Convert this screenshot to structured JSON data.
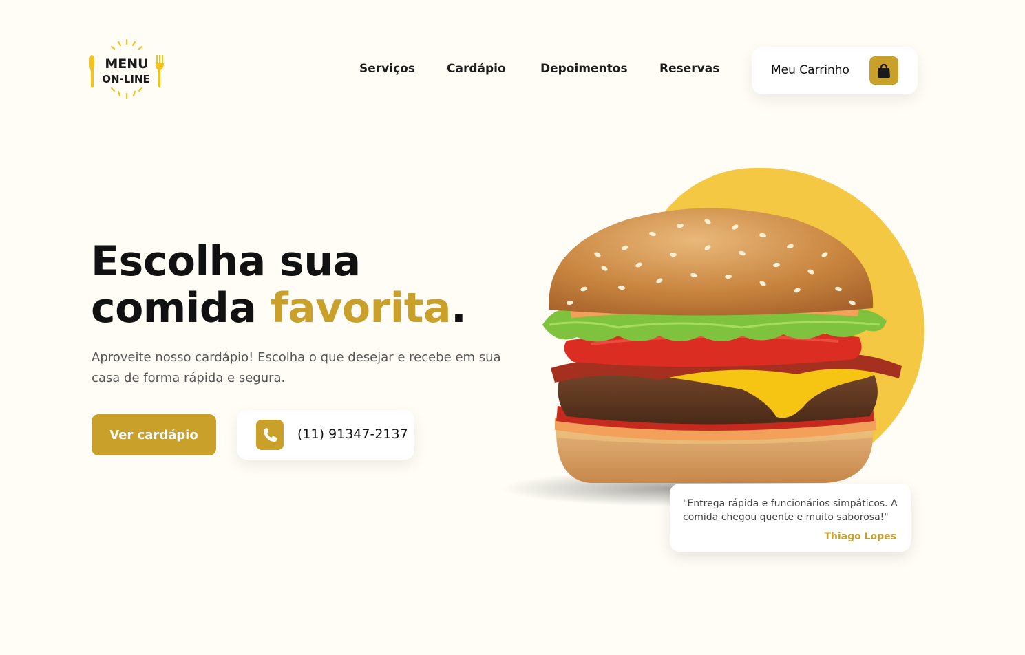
{
  "brand": {
    "logo_line1": "MENU",
    "logo_line2": "ON-LINE",
    "logo_color": "#f4c21a"
  },
  "nav": {
    "items": [
      {
        "label": "Serviços"
      },
      {
        "label": "Cardápio"
      },
      {
        "label": "Depoimentos"
      },
      {
        "label": "Reservas"
      }
    ]
  },
  "cart": {
    "label": "Meu Carrinho",
    "icon": "shopping-bag-icon"
  },
  "hero": {
    "title_line1": "Escolha sua",
    "title_line2_prefix": "comida ",
    "title_highlight": "favorita",
    "title_suffix": ".",
    "subtitle": "Aproveite nosso cardápio! Escolha o que desejar e recebe em sua casa de forma rápida e segura.",
    "cta_label": "Ver cardápio",
    "phone_icon": "phone-icon",
    "phone_number": "(11) 91347-2137"
  },
  "testimonial": {
    "quote": "\"Entrega rápida e funcionários simpáticos. A comida chegou quente e muito saborosa!\"",
    "author": "Thiago Lopes"
  },
  "colors": {
    "accent": "#c9a12a",
    "blob": "#f4c842",
    "background": "#fffdf6",
    "text": "#111111"
  }
}
